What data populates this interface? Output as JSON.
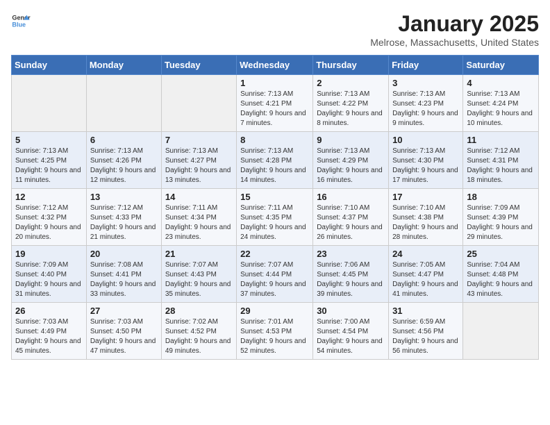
{
  "header": {
    "logo_general": "General",
    "logo_blue": "Blue",
    "month": "January 2025",
    "location": "Melrose, Massachusetts, United States"
  },
  "days_of_week": [
    "Sunday",
    "Monday",
    "Tuesday",
    "Wednesday",
    "Thursday",
    "Friday",
    "Saturday"
  ],
  "weeks": [
    [
      {
        "day": "",
        "info": ""
      },
      {
        "day": "",
        "info": ""
      },
      {
        "day": "",
        "info": ""
      },
      {
        "day": "1",
        "info": "Sunrise: 7:13 AM\nSunset: 4:21 PM\nDaylight: 9 hours and 7 minutes."
      },
      {
        "day": "2",
        "info": "Sunrise: 7:13 AM\nSunset: 4:22 PM\nDaylight: 9 hours and 8 minutes."
      },
      {
        "day": "3",
        "info": "Sunrise: 7:13 AM\nSunset: 4:23 PM\nDaylight: 9 hours and 9 minutes."
      },
      {
        "day": "4",
        "info": "Sunrise: 7:13 AM\nSunset: 4:24 PM\nDaylight: 9 hours and 10 minutes."
      }
    ],
    [
      {
        "day": "5",
        "info": "Sunrise: 7:13 AM\nSunset: 4:25 PM\nDaylight: 9 hours and 11 minutes."
      },
      {
        "day": "6",
        "info": "Sunrise: 7:13 AM\nSunset: 4:26 PM\nDaylight: 9 hours and 12 minutes."
      },
      {
        "day": "7",
        "info": "Sunrise: 7:13 AM\nSunset: 4:27 PM\nDaylight: 9 hours and 13 minutes."
      },
      {
        "day": "8",
        "info": "Sunrise: 7:13 AM\nSunset: 4:28 PM\nDaylight: 9 hours and 14 minutes."
      },
      {
        "day": "9",
        "info": "Sunrise: 7:13 AM\nSunset: 4:29 PM\nDaylight: 9 hours and 16 minutes."
      },
      {
        "day": "10",
        "info": "Sunrise: 7:13 AM\nSunset: 4:30 PM\nDaylight: 9 hours and 17 minutes."
      },
      {
        "day": "11",
        "info": "Sunrise: 7:12 AM\nSunset: 4:31 PM\nDaylight: 9 hours and 18 minutes."
      }
    ],
    [
      {
        "day": "12",
        "info": "Sunrise: 7:12 AM\nSunset: 4:32 PM\nDaylight: 9 hours and 20 minutes."
      },
      {
        "day": "13",
        "info": "Sunrise: 7:12 AM\nSunset: 4:33 PM\nDaylight: 9 hours and 21 minutes."
      },
      {
        "day": "14",
        "info": "Sunrise: 7:11 AM\nSunset: 4:34 PM\nDaylight: 9 hours and 23 minutes."
      },
      {
        "day": "15",
        "info": "Sunrise: 7:11 AM\nSunset: 4:35 PM\nDaylight: 9 hours and 24 minutes."
      },
      {
        "day": "16",
        "info": "Sunrise: 7:10 AM\nSunset: 4:37 PM\nDaylight: 9 hours and 26 minutes."
      },
      {
        "day": "17",
        "info": "Sunrise: 7:10 AM\nSunset: 4:38 PM\nDaylight: 9 hours and 28 minutes."
      },
      {
        "day": "18",
        "info": "Sunrise: 7:09 AM\nSunset: 4:39 PM\nDaylight: 9 hours and 29 minutes."
      }
    ],
    [
      {
        "day": "19",
        "info": "Sunrise: 7:09 AM\nSunset: 4:40 PM\nDaylight: 9 hours and 31 minutes."
      },
      {
        "day": "20",
        "info": "Sunrise: 7:08 AM\nSunset: 4:41 PM\nDaylight: 9 hours and 33 minutes."
      },
      {
        "day": "21",
        "info": "Sunrise: 7:07 AM\nSunset: 4:43 PM\nDaylight: 9 hours and 35 minutes."
      },
      {
        "day": "22",
        "info": "Sunrise: 7:07 AM\nSunset: 4:44 PM\nDaylight: 9 hours and 37 minutes."
      },
      {
        "day": "23",
        "info": "Sunrise: 7:06 AM\nSunset: 4:45 PM\nDaylight: 9 hours and 39 minutes."
      },
      {
        "day": "24",
        "info": "Sunrise: 7:05 AM\nSunset: 4:47 PM\nDaylight: 9 hours and 41 minutes."
      },
      {
        "day": "25",
        "info": "Sunrise: 7:04 AM\nSunset: 4:48 PM\nDaylight: 9 hours and 43 minutes."
      }
    ],
    [
      {
        "day": "26",
        "info": "Sunrise: 7:03 AM\nSunset: 4:49 PM\nDaylight: 9 hours and 45 minutes."
      },
      {
        "day": "27",
        "info": "Sunrise: 7:03 AM\nSunset: 4:50 PM\nDaylight: 9 hours and 47 minutes."
      },
      {
        "day": "28",
        "info": "Sunrise: 7:02 AM\nSunset: 4:52 PM\nDaylight: 9 hours and 49 minutes."
      },
      {
        "day": "29",
        "info": "Sunrise: 7:01 AM\nSunset: 4:53 PM\nDaylight: 9 hours and 52 minutes."
      },
      {
        "day": "30",
        "info": "Sunrise: 7:00 AM\nSunset: 4:54 PM\nDaylight: 9 hours and 54 minutes."
      },
      {
        "day": "31",
        "info": "Sunrise: 6:59 AM\nSunset: 4:56 PM\nDaylight: 9 hours and 56 minutes."
      },
      {
        "day": "",
        "info": ""
      }
    ]
  ]
}
